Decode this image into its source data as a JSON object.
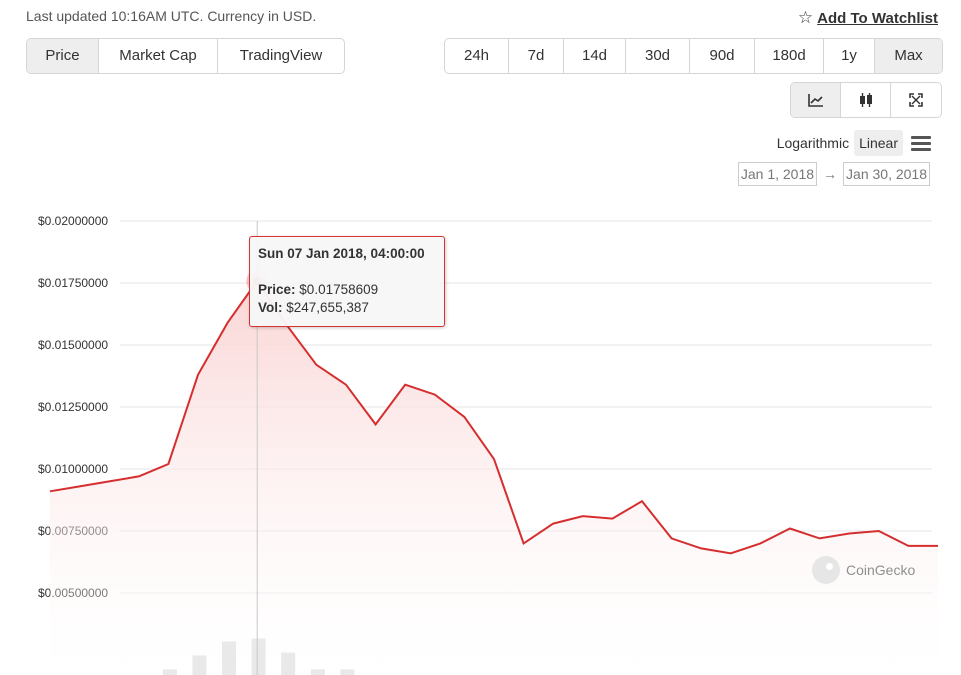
{
  "header": {
    "last_updated": "Last updated 10:16AM UTC. Currency in USD.",
    "watchlist_label": "Add To Watchlist"
  },
  "view_tabs": [
    {
      "label": "Price",
      "active": true
    },
    {
      "label": "Market Cap",
      "active": false
    },
    {
      "label": "TradingView",
      "active": false
    }
  ],
  "range_tabs": [
    {
      "label": "24h",
      "active": false
    },
    {
      "label": "7d",
      "active": false
    },
    {
      "label": "14d",
      "active": false
    },
    {
      "label": "30d",
      "active": false
    },
    {
      "label": "90d",
      "active": false
    },
    {
      "label": "180d",
      "active": false
    },
    {
      "label": "1y",
      "active": false
    },
    {
      "label": "Max",
      "active": true
    }
  ],
  "chart_type_buttons": [
    {
      "icon": "line-chart-icon",
      "active": true
    },
    {
      "icon": "candlestick-icon",
      "active": false
    },
    {
      "icon": "fullscreen-icon",
      "active": false
    }
  ],
  "scale": {
    "logarithmic_label": "Logarithmic",
    "linear_label": "Linear",
    "active": "Linear"
  },
  "date_range": {
    "from": "Jan 1, 2018",
    "arrow": "→",
    "to": "Jan 30, 2018"
  },
  "tooltip": {
    "date": "Sun 07 Jan 2018, 04:00:00",
    "price_label": "Price:",
    "price_value": "$0.01758609",
    "vol_label": "Vol:",
    "vol_value": "$247,655,387"
  },
  "credits": "CoinGecko",
  "colors": {
    "line": "#d62e2e",
    "area_top": "#fad2d2",
    "volume": "#e3e3e3",
    "grid": "#e6e6e6",
    "text": "#333333",
    "axis_text": "#333333"
  },
  "chart_data": {
    "type": "area",
    "title": "",
    "xlabel": "",
    "ylabel": "",
    "ylim": [
      0.005,
      0.02
    ],
    "y_ticks": [
      "$0.02000000",
      "$0.01750000",
      "$0.01500000",
      "$0.01250000",
      "$0.01000000",
      "$0.00750000",
      "$0.00500000"
    ],
    "y_tick_values": [
      0.02,
      0.0175,
      0.015,
      0.0125,
      0.01,
      0.0075,
      0.005
    ],
    "grid": true,
    "highlight_index": 6,
    "series": [
      {
        "values": [
          0.0091,
          0.0093,
          0.0095,
          0.0097,
          0.0102,
          0.0138,
          0.0159,
          0.01758609,
          0.0158,
          0.0142,
          0.0134,
          0.0118,
          0.0134,
          0.013,
          0.0121,
          0.0104,
          0.007,
          0.0078,
          0.0081,
          0.008,
          0.0087,
          0.0072,
          0.0068,
          0.0066,
          0.007,
          0.0076,
          0.0072,
          0.0074,
          0.0075,
          0.0069,
          0.0069
        ]
      }
    ],
    "volume": [
      0,
      0,
      0,
      20,
      70,
      120,
      130,
      80,
      20,
      20
    ]
  }
}
